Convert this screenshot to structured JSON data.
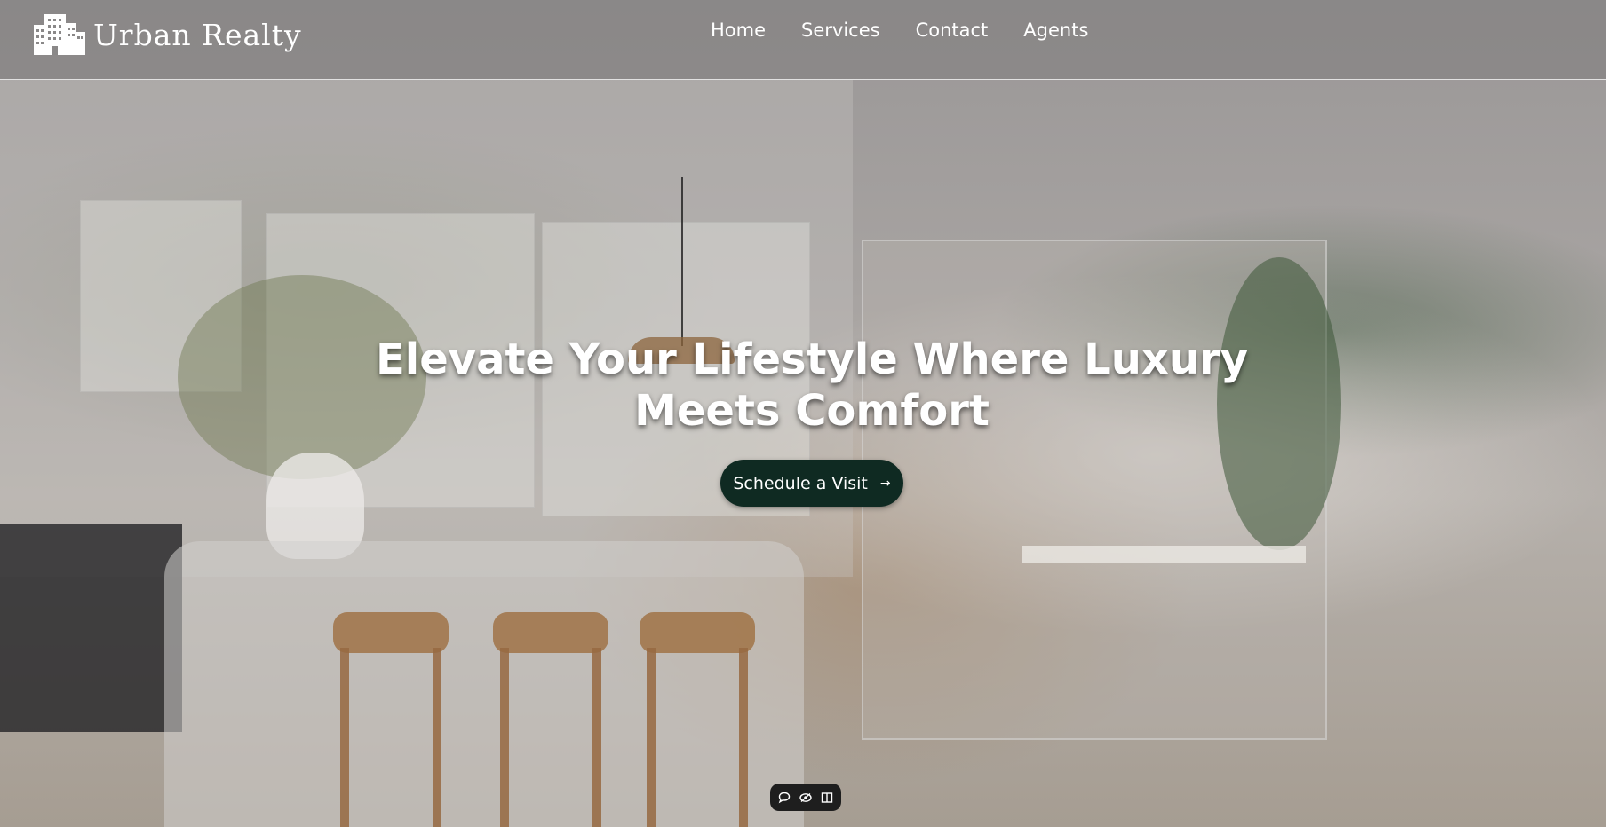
{
  "brand": {
    "name": "Urban Realty",
    "icon": "city-buildings-icon"
  },
  "nav": {
    "items": [
      {
        "label": "Home"
      },
      {
        "label": "Services"
      },
      {
        "label": "Contact"
      },
      {
        "label": "Agents"
      }
    ]
  },
  "hero": {
    "headline_line1": "Elevate Your Lifestyle Where Luxury",
    "headline_line2": "Meets Comfort",
    "cta_label": "Schedule a Visit",
    "cta_arrow": "→",
    "cta_color": "#0f2a22"
  },
  "toolbar": {
    "icons": [
      "comment-icon",
      "eye-icon",
      "columns-icon"
    ]
  }
}
